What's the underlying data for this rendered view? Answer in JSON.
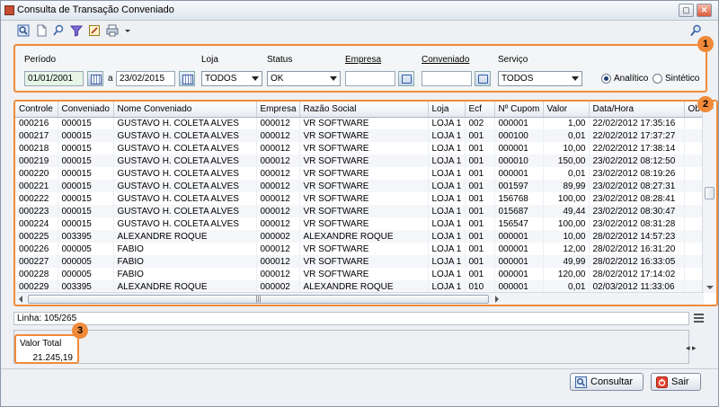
{
  "window": {
    "title": "Consulta de Transação Conveniado"
  },
  "toolbar": {
    "icons": [
      "search-icon",
      "new-document-icon",
      "key-search-icon",
      "filter-icon",
      "edit-icon",
      "print-icon",
      "dropdown-arrow-icon"
    ],
    "right_icon": "search-key-icon"
  },
  "filters": {
    "periodo_label": "Período",
    "date_from": "01/01/2001",
    "date_sep": "a",
    "date_to": "23/02/2015",
    "loja_label": "Loja",
    "loja_value": "TODOS",
    "status_label": "Status",
    "status_value": "OK",
    "empresa_label": "Empresa",
    "empresa_value": "",
    "conveniado_label": "Conveniado",
    "conveniado_value": "",
    "servico_label": "Serviço",
    "servico_value": "TODOS",
    "radio_analitico": "Analítico",
    "radio_sintetico": "Sintético"
  },
  "badges": {
    "one": "1",
    "two": "2",
    "three": "3"
  },
  "grid": {
    "headers": [
      "Controle",
      "Conveniado",
      "Nome Conveniado",
      "Empresa",
      "Razão Social",
      "Loja",
      "Ecf",
      "Nº Cupom",
      "Valor",
      "Data/Hora",
      "Ob"
    ],
    "rows": [
      [
        "000216",
        "000015",
        "GUSTAVO H. COLETA ALVES",
        "000012",
        "VR SOFTWARE",
        "LOJA 1",
        "002",
        "000001",
        "1,00",
        "22/02/2012 17:35:16"
      ],
      [
        "000217",
        "000015",
        "GUSTAVO H. COLETA ALVES",
        "000012",
        "VR SOFTWARE",
        "LOJA 1",
        "001",
        "000100",
        "0,01",
        "22/02/2012 17:37:27"
      ],
      [
        "000218",
        "000015",
        "GUSTAVO H. COLETA ALVES",
        "000012",
        "VR SOFTWARE",
        "LOJA 1",
        "001",
        "000001",
        "10,00",
        "22/02/2012 17:38:14"
      ],
      [
        "000219",
        "000015",
        "GUSTAVO H. COLETA ALVES",
        "000012",
        "VR SOFTWARE",
        "LOJA 1",
        "001",
        "000010",
        "150,00",
        "23/02/2012 08:12:50"
      ],
      [
        "000220",
        "000015",
        "GUSTAVO H. COLETA ALVES",
        "000012",
        "VR SOFTWARE",
        "LOJA 1",
        "001",
        "000001",
        "0,01",
        "23/02/2012 08:19:26"
      ],
      [
        "000221",
        "000015",
        "GUSTAVO H. COLETA ALVES",
        "000012",
        "VR SOFTWARE",
        "LOJA 1",
        "001",
        "001597",
        "89,99",
        "23/02/2012 08:27:31"
      ],
      [
        "000222",
        "000015",
        "GUSTAVO H. COLETA ALVES",
        "000012",
        "VR SOFTWARE",
        "LOJA 1",
        "001",
        "156768",
        "100,00",
        "23/02/2012 08:28:41"
      ],
      [
        "000223",
        "000015",
        "GUSTAVO H. COLETA ALVES",
        "000012",
        "VR SOFTWARE",
        "LOJA 1",
        "001",
        "015687",
        "49,44",
        "23/02/2012 08:30:47"
      ],
      [
        "000224",
        "000015",
        "GUSTAVO H. COLETA ALVES",
        "000012",
        "VR SOFTWARE",
        "LOJA 1",
        "001",
        "156547",
        "100,00",
        "23/02/2012 08:31:28"
      ],
      [
        "000225",
        "003395",
        "ALEXANDRE ROQUE",
        "000002",
        "ALEXANDRE ROQUE",
        "LOJA 1",
        "001",
        "000001",
        "10,00",
        "28/02/2012 14:57:23"
      ],
      [
        "000226",
        "000005",
        "FABIO",
        "000012",
        "VR SOFTWARE",
        "LOJA 1",
        "001",
        "000001",
        "12,00",
        "28/02/2012 16:31:20"
      ],
      [
        "000227",
        "000005",
        "FABIO",
        "000012",
        "VR SOFTWARE",
        "LOJA 1",
        "001",
        "000001",
        "49,99",
        "28/02/2012 16:33:05"
      ],
      [
        "000228",
        "000005",
        "FABIO",
        "000012",
        "VR SOFTWARE",
        "LOJA 1",
        "001",
        "000001",
        "120,00",
        "28/02/2012 17:14:02"
      ],
      [
        "000229",
        "003395",
        "ALEXANDRE ROQUE",
        "000002",
        "ALEXANDRE ROQUE",
        "LOJA 1",
        "010",
        "000001",
        "0,01",
        "02/03/2012 11:33:06"
      ]
    ]
  },
  "status": {
    "linha": "Linha: 105/265"
  },
  "totals": {
    "label": "Valor Total",
    "value": "21.245,19"
  },
  "buttons": {
    "consultar": "Consultar",
    "sair": "Sair"
  },
  "colors": {
    "highlight": "#f08a3a",
    "accent": "#1c3f73"
  }
}
